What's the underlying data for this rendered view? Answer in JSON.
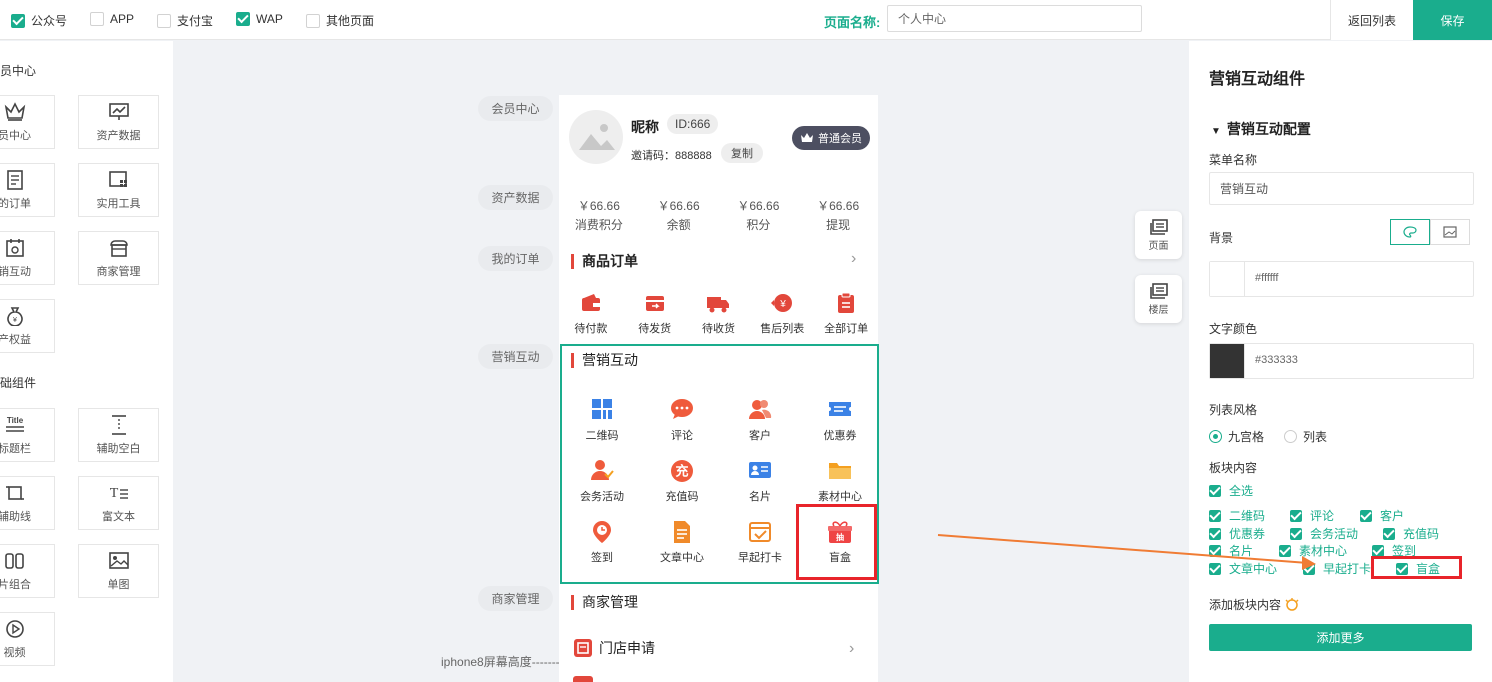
{
  "topbar": {
    "platforms": [
      {
        "label": "公众号",
        "checked": true
      },
      {
        "label": "APP",
        "checked": false
      },
      {
        "label": "支付宝",
        "checked": false
      },
      {
        "label": "WAP",
        "checked": true
      },
      {
        "label": "其他页面",
        "checked": false
      }
    ],
    "page_name_label": "页面名称:",
    "page_name_value": "个人中心",
    "back_label": "返回列表",
    "save_label": "保存"
  },
  "left": {
    "section1": "员中心",
    "section2": "础组件",
    "tiles1": [
      "员中心",
      "资产数据",
      "的订单",
      "实用工具",
      "销互动",
      "商家管理",
      "产权益"
    ],
    "tiles2": [
      "标题栏",
      "辅助空白",
      "辅助线",
      "富文本",
      "片组合",
      "单图",
      "视频"
    ],
    "title_icon_text": "Title"
  },
  "canvas": {
    "pills": [
      "会员中心",
      "资产数据",
      "我的订单",
      "营销互动",
      "商家管理"
    ],
    "iphone_label": "iphone8屏幕高度-------"
  },
  "phone": {
    "nickname": "昵称",
    "id": "ID:666",
    "invite": "邀请码：888888",
    "copy": "复制",
    "vip": "普通会员",
    "stats": [
      {
        "value": "￥66.66",
        "label": "消费积分"
      },
      {
        "value": "￥66.66",
        "label": "余额"
      },
      {
        "value": "￥66.66",
        "label": "积分"
      },
      {
        "value": "￥66.66",
        "label": "提现"
      }
    ],
    "orders_title": "商品订单",
    "orders": [
      "待付款",
      "待发货",
      "待收货",
      "售后列表",
      "全部订单"
    ],
    "marketing_title": "营销互动",
    "marketing": [
      "二维码",
      "评论",
      "客户",
      "优惠券",
      "会务活动",
      "充值码",
      "名片",
      "素材中心",
      "签到",
      "文章中心",
      "早起打卡",
      "盲盒"
    ],
    "recharge_glyph": "充",
    "blindbox_glyph": "抽",
    "merchant_title": "商家管理",
    "store_apply": "门店申请"
  },
  "tools": {
    "page": "页面",
    "layer": "楼层"
  },
  "right": {
    "title": "营销互动组件",
    "config_title": "营销互动配置",
    "menu_name_label": "菜单名称",
    "menu_name_value": "营销互动",
    "bg_label": "背景",
    "bg_color": "#ffffff",
    "text_color_label": "文字颜色",
    "text_color": "#333333",
    "list_style_label": "列表风格",
    "style_grid": "九宫格",
    "style_list": "列表",
    "block_content_label": "板块内容",
    "select_all": "全选",
    "items": [
      "二维码",
      "评论",
      "客户",
      "优惠券",
      "会务活动",
      "充值码",
      "名片",
      "素材中心",
      "签到",
      "文章中心",
      "早起打卡",
      "盲盒"
    ],
    "add_block_label": "添加板块内容",
    "add_more": "添加更多"
  },
  "colors": {
    "accent": "#1aad8d",
    "red": "#e2473b",
    "highlight": "#e8242a",
    "arrow": "#f07c34"
  }
}
